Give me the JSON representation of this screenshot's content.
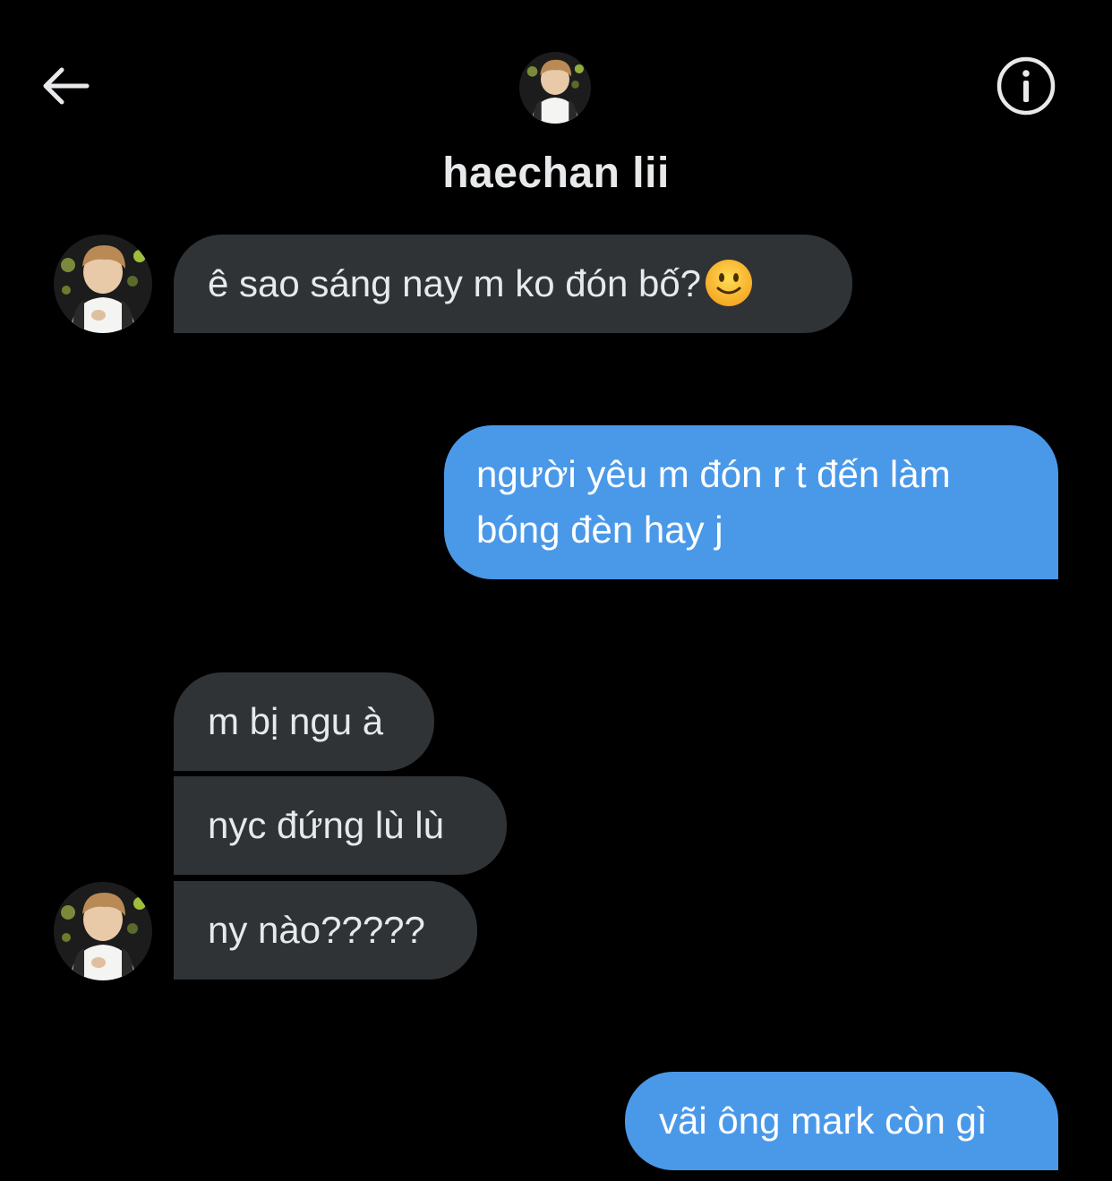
{
  "header": {
    "contact_name": "haechan lii",
    "back_icon": "arrow-left-icon",
    "info_icon": "info-circle-icon"
  },
  "colors": {
    "background": "#000000",
    "incoming_bubble": "#2f3336",
    "outgoing_bubble": "#4a99e9",
    "text": "#e7e9ea"
  },
  "messages": [
    {
      "direction": "in",
      "text": "ê sao sáng nay m ko đón bố?",
      "emoji": "slightly-smiling-face"
    },
    {
      "direction": "out",
      "line1": "người yêu m đón r t đến làm",
      "line2": "bóng đèn hay j"
    },
    {
      "direction": "in",
      "text": "m bị ngu à"
    },
    {
      "direction": "in",
      "text": "nyc đứng lù lù"
    },
    {
      "direction": "in",
      "text": "ny nào?????"
    },
    {
      "direction": "out",
      "text": "vãi ông mark còn gì"
    }
  ]
}
